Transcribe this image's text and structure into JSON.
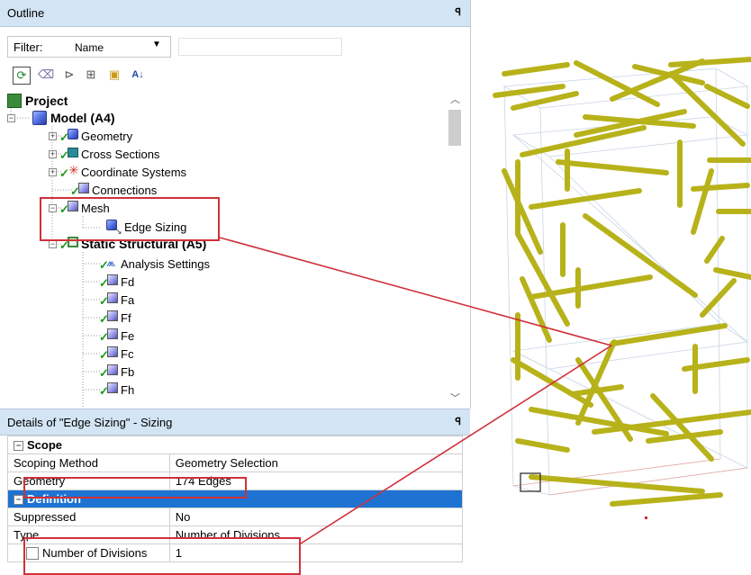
{
  "outline": {
    "title": "Outline",
    "pin": "ꟼ",
    "filter_label": "Filter:",
    "filter_value": "Name",
    "filter_text": ""
  },
  "toolbar_icons": [
    "refresh-icon",
    "eraser-icon",
    "node-icon",
    "expand-all-icon",
    "folder-icon",
    "sort-az-icon"
  ],
  "tree": {
    "project": "Project",
    "model": "Model (A4)",
    "geometry": "Geometry",
    "cross_sections": "Cross Sections",
    "coordinate_systems": "Coordinate Systems",
    "connections": "Connections",
    "mesh": "Mesh",
    "edge_sizing": "Edge Sizing",
    "static_structural": "Static Structural (A5)",
    "analysis_settings": "Analysis Settings",
    "forces": [
      "Fd",
      "Fa",
      "Ff",
      "Fe",
      "Fc",
      "Fb",
      "Fh"
    ]
  },
  "details": {
    "title": "Details of \"Edge Sizing\" - Sizing",
    "pin": "ꟼ",
    "scope_header": "Scope",
    "scoping_method_label": "Scoping Method",
    "scoping_method_value": "Geometry Selection",
    "geometry_label": "Geometry",
    "geometry_value": "174 Edges",
    "definition_header": "Definition",
    "suppressed_label": "Suppressed",
    "suppressed_value": "No",
    "type_label": "Type",
    "type_value": "Number of Divisions",
    "divisions_label": "Number of Divisions",
    "divisions_value": "1"
  },
  "colors": {
    "titlebar": "#d3e4f4",
    "highlight": "#d0303a",
    "selected_section": "#1e73d2",
    "beam": "#b7b21a",
    "check": "#1a9a1a"
  }
}
